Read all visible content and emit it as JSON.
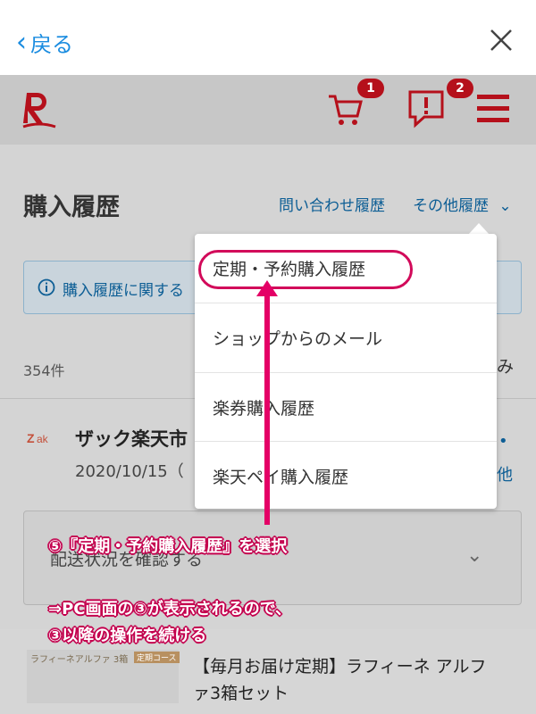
{
  "browser": {
    "back_label": "戻る"
  },
  "header": {
    "cart_badge": "1",
    "notice_badge": "2",
    "accent_color": "#b5101b"
  },
  "page": {
    "title": "購入履歴",
    "link_inquiry": "問い合わせ履歴",
    "link_other": "その他履歴",
    "info_text": "購入履歴に関する",
    "count": "354件",
    "right_partial": "み"
  },
  "order": {
    "shop_logo": "Zak",
    "shop_name": "ザック楽天市",
    "date": "2020/10/15（",
    "dot": "•",
    "other": "他",
    "shipping_label": "配送状況を確認する",
    "product_image_label": "ラフィーネアルファ 3箱",
    "product_image_tag": "定期コース",
    "product_title": "【毎月お届け定期】ラフィーネ アルファ3箱セット"
  },
  "dropdown": {
    "items": [
      "定期・予約購入履歴",
      "ショップからのメール",
      "楽券購入履歴",
      "楽天ペイ購入履歴"
    ]
  },
  "annotation": {
    "line1": "⑤『定期・予約購入履歴』を選択",
    "line2": "⇒PC画面の③が表示されるので、",
    "line3": "③以降の操作を続ける",
    "color": "#e40066"
  }
}
